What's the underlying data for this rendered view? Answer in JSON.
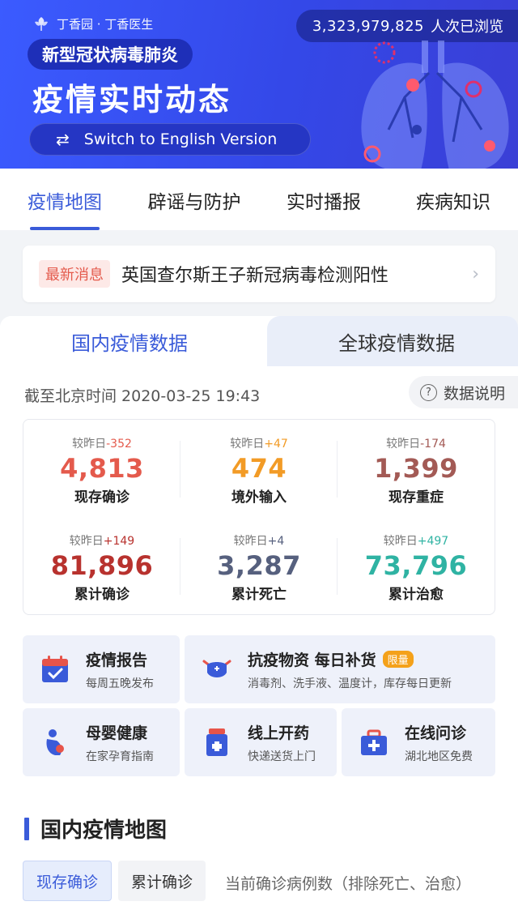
{
  "header": {
    "brand": "丁香园 · 丁香医生",
    "views_count": "3,323,979,825",
    "views_suffix": "人次已浏览",
    "pill": "新型冠状病毒肺炎",
    "title": "疫情实时动态",
    "switch_label": "Switch to English Version",
    "switch_icon": "swap-arrows-icon",
    "lungs_icon": "lungs-illustration"
  },
  "tabs": [
    {
      "label": "疫情地图",
      "active": true
    },
    {
      "label": "辟谣与防护",
      "active": false
    },
    {
      "label": "实时播报",
      "active": false
    },
    {
      "label": "疾病知识",
      "active": false
    }
  ],
  "news": {
    "badge": "最新消息",
    "text": "英国查尔斯王子新冠病毒检测阳性",
    "icon": "chevron-right-icon"
  },
  "data_tabs": {
    "domestic": "国内疫情数据",
    "global": "全球疫情数据"
  },
  "timestamp": "截至北京时间 2020-03-25 19:43",
  "explain": {
    "label": "数据说明",
    "icon": "question-circle-icon"
  },
  "stats": [
    {
      "delta_prefix": "较昨日",
      "delta": "-352",
      "value": "4,813",
      "label": "现存确诊",
      "color": "#e45a4c"
    },
    {
      "delta_prefix": "较昨日",
      "delta": "+47",
      "value": "474",
      "label": "境外输入",
      "color": "#f29b26"
    },
    {
      "delta_prefix": "较昨日",
      "delta": "-174",
      "value": "1,399",
      "label": "现存重症",
      "color": "#a35a55"
    },
    {
      "delta_prefix": "较昨日",
      "delta": "+149",
      "value": "81,896",
      "label": "累计确诊",
      "color": "#b8322e"
    },
    {
      "delta_prefix": "较昨日",
      "delta": "+4",
      "value": "3,287",
      "label": "累计死亡",
      "color": "#56607e"
    },
    {
      "delta_prefix": "较昨日",
      "delta": "+497",
      "value": "73,796",
      "label": "累计治愈",
      "color": "#2fb3a3"
    }
  ],
  "services": [
    {
      "title": "疫情报告",
      "sub": "每周五晚发布",
      "icon": "calendar-check-icon"
    },
    {
      "title": "抗疫物资 每日补货",
      "badge": "限量",
      "sub": "消毒剂、洗手液、温度计，库存每日更新",
      "icon": "mask-icon"
    },
    {
      "title": "母婴健康",
      "sub": "在家孕育指南",
      "icon": "mother-baby-icon"
    },
    {
      "title": "线上开药",
      "sub": "快递送货上门",
      "icon": "medicine-bottle-icon"
    },
    {
      "title": "在线问诊",
      "sub": "湖北地区免费",
      "icon": "medical-kit-icon"
    }
  ],
  "map_section": {
    "title": "国内疫情地图",
    "tab_current": "现存确诊",
    "tab_total": "累计确诊",
    "desc": "当前确诊病例数（排除死亡、治愈）"
  },
  "colors": {
    "header_bg": "#3448e8",
    "accent": "#3a5bd9",
    "news_red": "#e45a4c",
    "limit_badge": "#f4a11a"
  }
}
